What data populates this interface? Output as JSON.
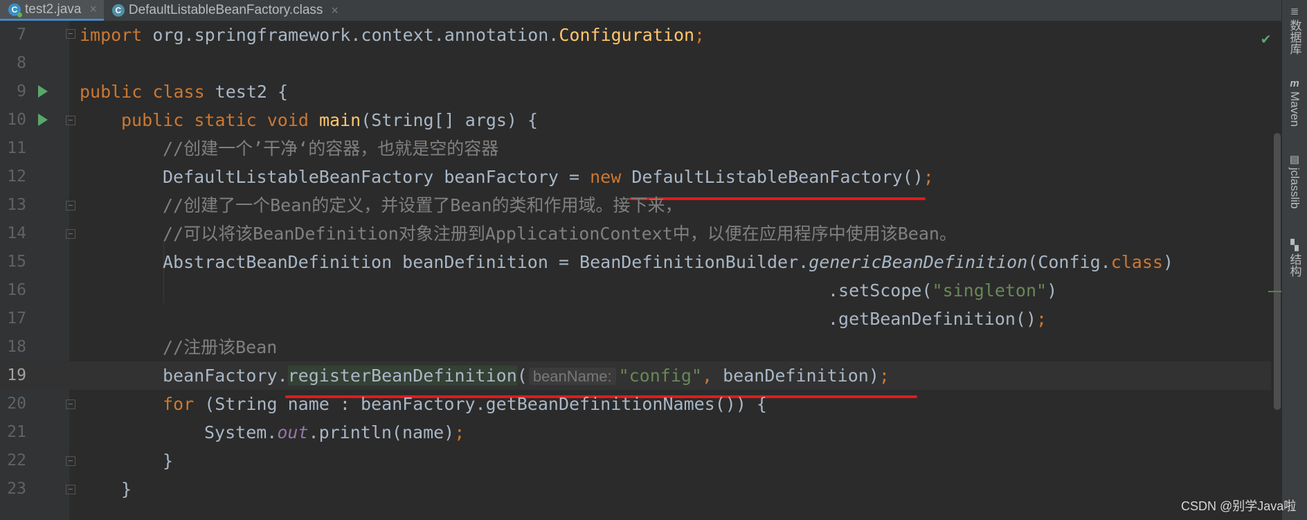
{
  "tabs": [
    {
      "label": "test2.java",
      "icon": "java-class-icon"
    },
    {
      "label": "DefaultListableBeanFactory.class",
      "icon": "class-file-icon"
    }
  ],
  "tab_close_glyph": "×",
  "right_panels": [
    {
      "label": "数据库",
      "icon": "database-icon"
    },
    {
      "label": "Maven",
      "icon": "maven-icon"
    },
    {
      "label": "jclasslib",
      "icon": "jclasslib-icon"
    },
    {
      "label": "结构",
      "icon": "structure-icon"
    }
  ],
  "lines": {
    "l7": {
      "num": "7",
      "t1": "import",
      "t2": " org.springframework.context.annotation.",
      "t3": "Configuration",
      "t4": ";"
    },
    "l8": {
      "num": "8"
    },
    "l9": {
      "num": "9",
      "t1": "public class",
      "t2": " test2 {"
    },
    "l10": {
      "num": "10",
      "t1": "public static void",
      "t2": " ",
      "t3": "main",
      "t4": "(String[] args) {"
    },
    "l11": {
      "num": "11",
      "t1": "//创建一个’干净‘的容器，也就是空的容器"
    },
    "l12": {
      "num": "12",
      "t1": "DefaultListableBeanFactory beanFactory = ",
      "t2": "new",
      "t3": " DefaultListableBeanFactory()",
      "t4": ";"
    },
    "l13": {
      "num": "13",
      "t1": "//创建了一个Bean的定义，并设置了Bean的类和作用域。接下来，"
    },
    "l14": {
      "num": "14",
      "t1": "//可以将该BeanDefinition对象注册到ApplicationContext中，以便在应用程序中使用该Bean。"
    },
    "l15": {
      "num": "15",
      "t1": "AbstractBeanDefinition beanDefinition = BeanDefinitionBuilder.",
      "t2": "genericBeanDefinition",
      "t3": "(Config.",
      "t4": "class",
      "t5": ")"
    },
    "l16": {
      "num": "16",
      "t1": ".setScope(",
      "t2": "\"singleton\"",
      "t3": ")"
    },
    "l17": {
      "num": "17",
      "t1": ".getBeanDefinition()",
      "t2": ";"
    },
    "l18": {
      "num": "18",
      "t1": "//注册该Bean"
    },
    "l19": {
      "num": "19",
      "t1": "beanFactory.",
      "t2": "registerBeanDefinition",
      "t3": "(",
      "hint": "beanName:",
      "t4": "\"config\"",
      "t5": ", ",
      "t6": "beanDefinition)",
      "t7": ";"
    },
    "l20": {
      "num": "20",
      "t1": "for",
      "t2": " (String name : beanFactory.getBeanDefinitionNames()) {"
    },
    "l21": {
      "num": "21",
      "t1": "System.",
      "t2": "out",
      "t3": ".println(name)",
      "t4": ";"
    },
    "l22": {
      "num": "22",
      "t1": "}"
    },
    "l23": {
      "num": "23",
      "t1": "}"
    }
  },
  "watermark": "CSDN @别学Java啦",
  "colors": {
    "keyword": "#cc7832",
    "string": "#6a8759",
    "comment": "#808080",
    "function": "#ffc66d",
    "annotation_underline": "#e11b1b"
  }
}
